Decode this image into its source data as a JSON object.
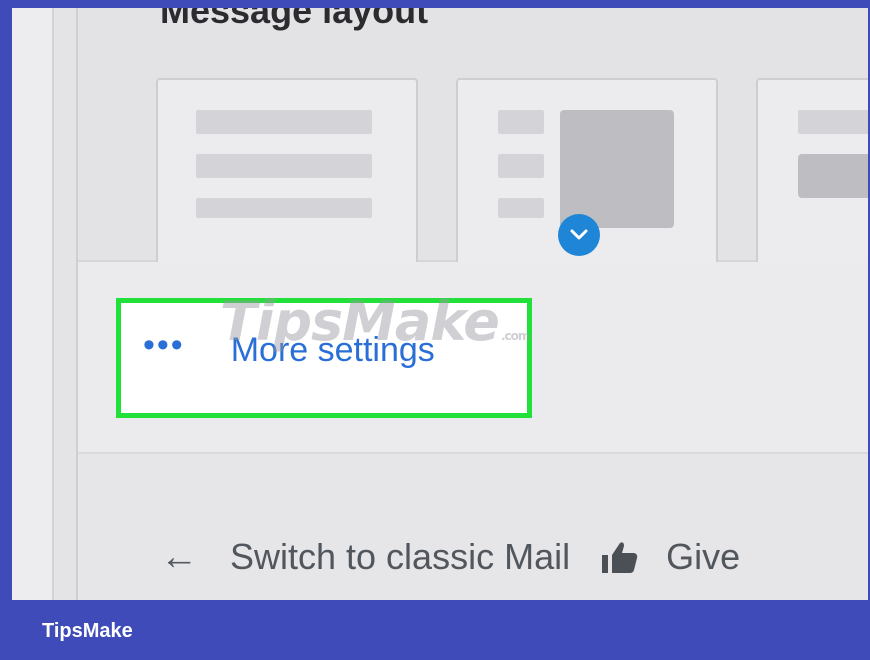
{
  "layout": {
    "title": "Message layout"
  },
  "more_settings": {
    "dots": "•••",
    "label": "More settings"
  },
  "switch": {
    "arrow": "←",
    "label": "Switch to classic Mail",
    "give_label": "Give"
  },
  "watermark": {
    "text": "TipsMake",
    "suffix": ".com"
  },
  "footer": {
    "brand": "TipsMake"
  },
  "colors": {
    "link": "#2a6fd6",
    "highlight_border": "#22e03a",
    "selected_badge": "#1f85d6",
    "footer_bg": "#3f4bb8"
  },
  "icons": {
    "selected": "chevron-down-icon",
    "back": "arrow-left-icon",
    "feedback": "thumbs-up-icon"
  }
}
